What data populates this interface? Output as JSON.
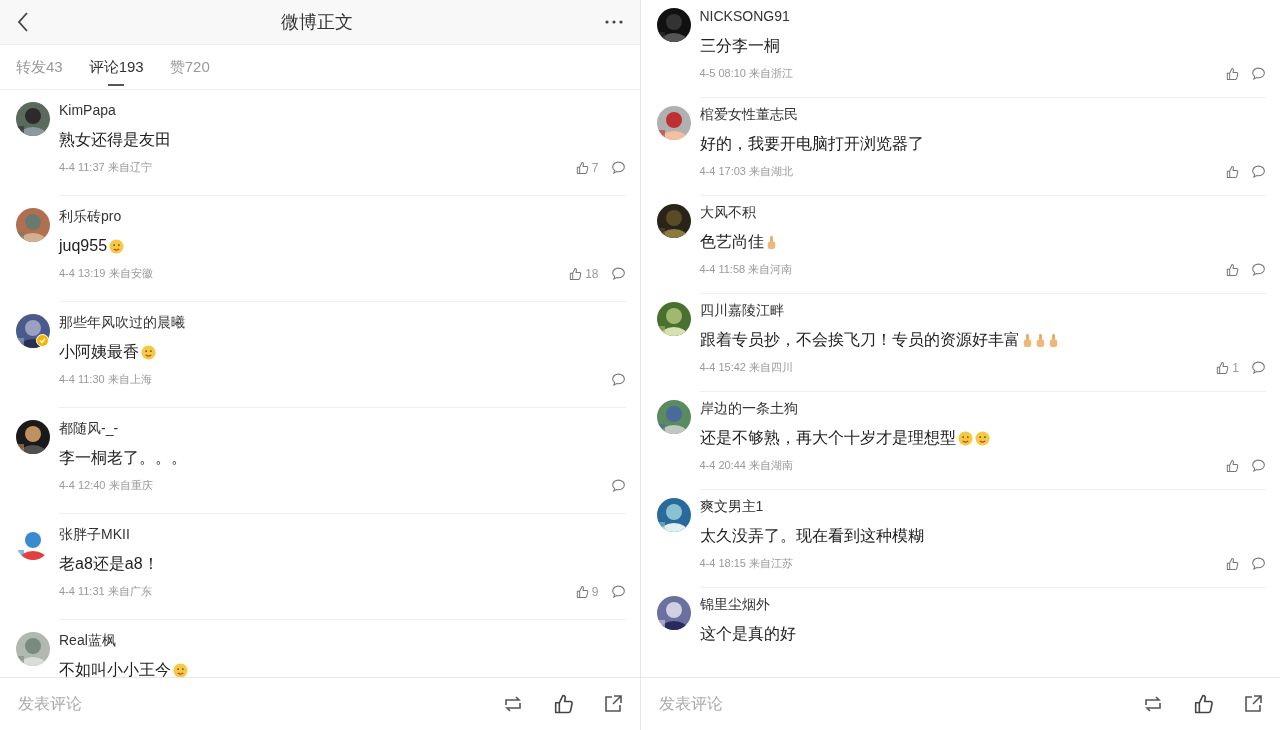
{
  "panels": [
    {
      "header": {
        "title": "微博正文"
      },
      "tabs": [
        {
          "label": "转发43",
          "selected": false
        },
        {
          "label": "评论193",
          "selected": true
        },
        {
          "label": "赞720",
          "selected": false
        }
      ],
      "comments": [
        {
          "user": "KimPapa",
          "text": "熟女还得是友田",
          "meta": "4-4 11:37 来自辽宁",
          "likes": "7"
        },
        {
          "user": "利乐砖pro",
          "text": "juq955",
          "emojis": [
            {
              "kind": "face"
            }
          ],
          "meta": "4-4 13:19 来自安徽",
          "likes": "18"
        },
        {
          "user": "那些年风吹过的晨曦",
          "verified": true,
          "text": "小阿姨最香",
          "emojis": [
            {
              "kind": "face"
            }
          ],
          "meta": "4-4 11:30 来自上海"
        },
        {
          "user": "都随风-_-",
          "text": "李一桐老了。。。",
          "meta": "4-4 12:40 来自重庆"
        },
        {
          "user": "张胖子MKII",
          "text": "老a8还是a8！",
          "meta": "4-4 11:31 来自广东",
          "likes": "9"
        },
        {
          "user": "Real蓝枫",
          "text": "不如叫小小王今",
          "emojis": [
            {
              "kind": "face"
            }
          ]
        }
      ],
      "composer": {
        "placeholder": "发表评论"
      }
    },
    {
      "comments": [
        {
          "user": "NICKSONG91",
          "text": "三分李一桐",
          "meta": "4-5 08:10 来自浙江",
          "show_like": true
        },
        {
          "user": "棺爱女性董志民",
          "text": "好的，我要开电脑打开浏览器了",
          "meta": "4-4 17:03 来自湖北",
          "show_like": true
        },
        {
          "user": "大风不积",
          "text": "色艺尚佳",
          "emojis": [
            {
              "kind": "thumb"
            }
          ],
          "meta": "4-4 11:58 来自河南",
          "show_like": true
        },
        {
          "user": "四川嘉陵江畔",
          "text": "跟着专员抄，不会挨飞刀！专员的资源好丰富",
          "emojis": [
            {
              "kind": "thumb"
            },
            {
              "kind": "thumb"
            },
            {
              "kind": "thumb"
            }
          ],
          "meta": "4-4 15:42 来自四川",
          "likes": "1"
        },
        {
          "user": "岸边的一条土狗",
          "text": "还是不够熟，再大个十岁才是理想型",
          "emojis": [
            {
              "kind": "face"
            },
            {
              "kind": "face"
            }
          ],
          "meta": "4-4 20:44 来自湖南",
          "show_like": true
        },
        {
          "user": "爽文男主1",
          "text": "太久没弄了。现在看到这种模糊",
          "meta": "4-4 18:15 来自江苏",
          "show_like": true
        },
        {
          "user": "锦里尘烟外",
          "text": "这个是真的好"
        }
      ],
      "composer": {
        "placeholder": "发表评论"
      }
    }
  ]
}
